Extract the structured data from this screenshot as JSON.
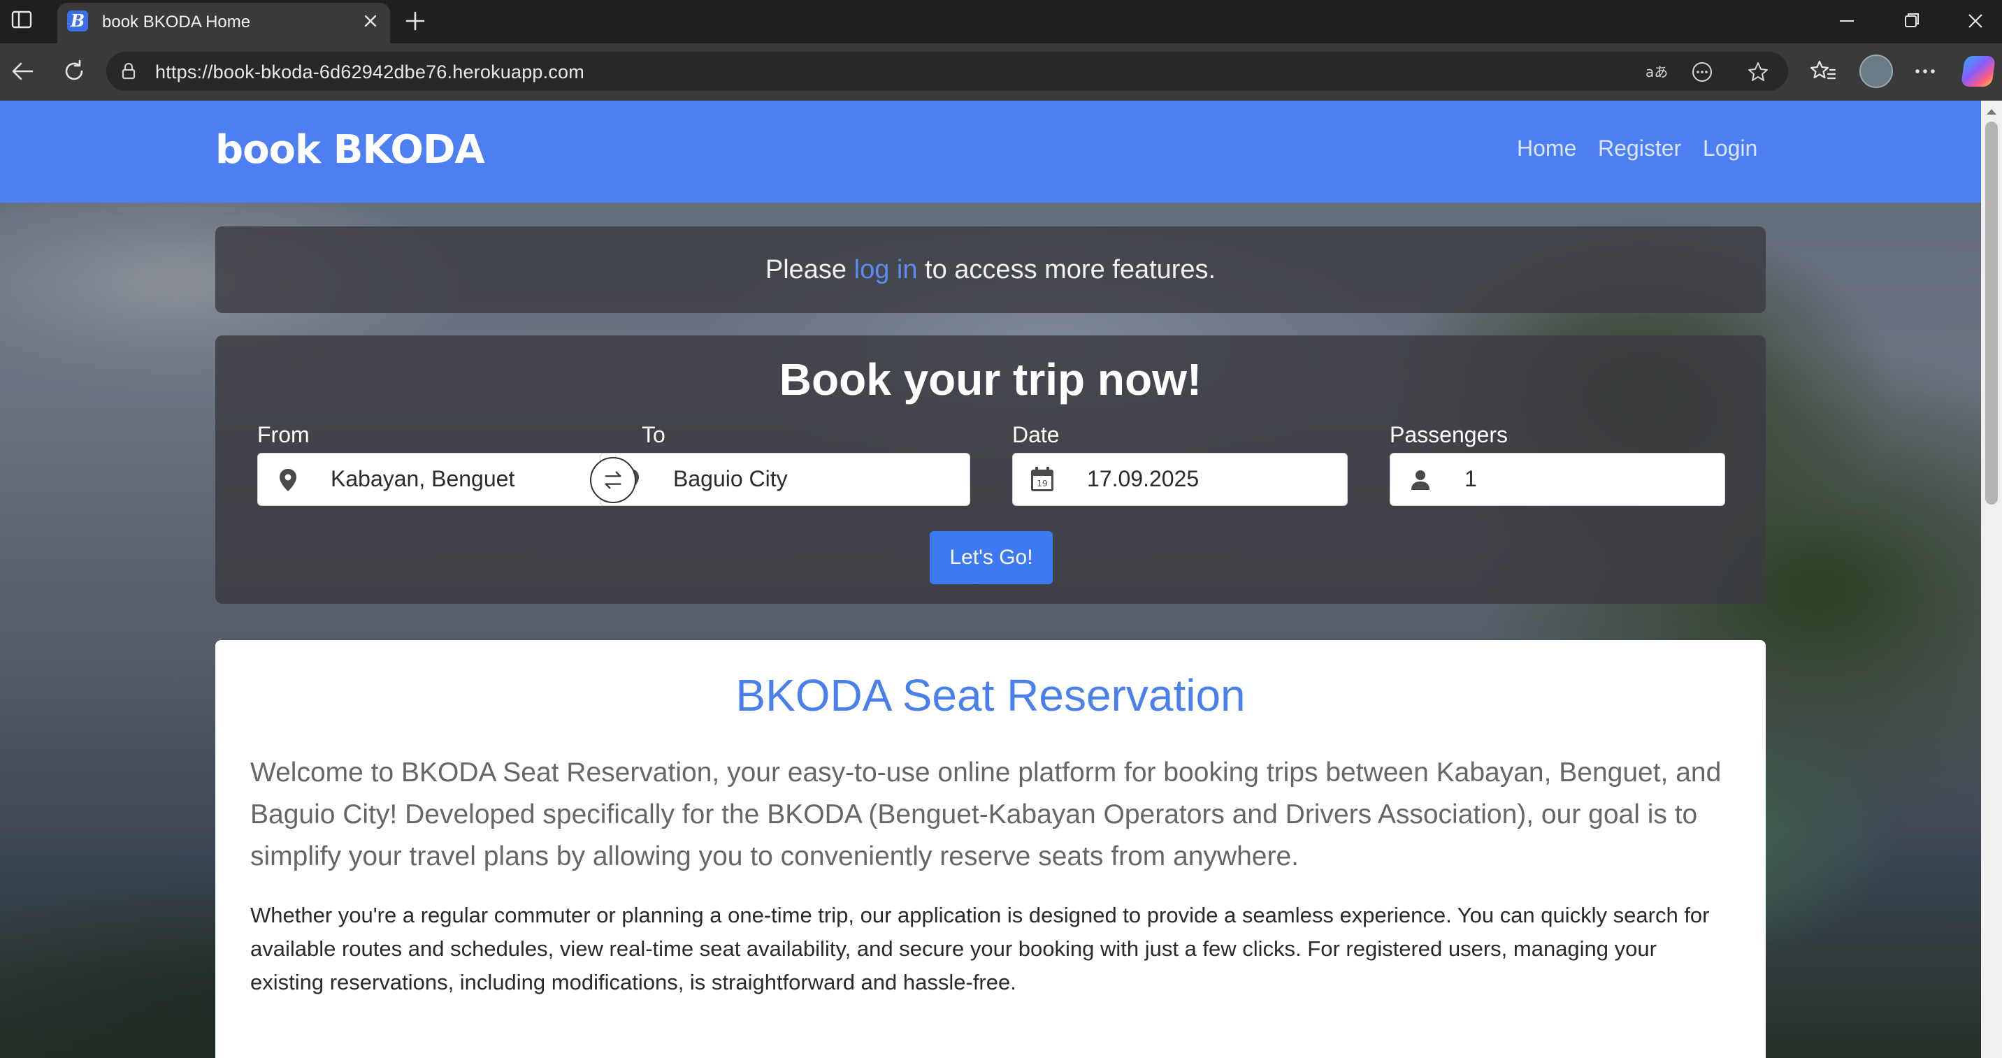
{
  "browser": {
    "tab_title": "book BKODA Home",
    "tab_favicon_letter": "B",
    "url": "https://book-bkoda-6d62942dbe76.herokuapp.com"
  },
  "navbar": {
    "brand": "book BKODA",
    "links": [
      "Home",
      "Register",
      "Login"
    ],
    "color": "#4d7ef2"
  },
  "notice": {
    "prefix": "Please",
    "link_text": "log in",
    "suffix": "to access more features."
  },
  "booking": {
    "heading": "Book your trip now!",
    "from_label": "From",
    "from_value": "Kabayan, Benguet",
    "to_label": "To",
    "to_value": "Baguio City",
    "date_label": "Date",
    "date_value": "17.09.2025",
    "date_icon_day": "19",
    "passengers_label": "Passengers",
    "passengers_value": "1",
    "submit_label": "Let's Go!"
  },
  "about": {
    "title": "BKODA Seat Reservation",
    "lead": "Welcome to BKODA Seat Reservation, your easy-to-use online platform for booking trips between Kabayan, Benguet, and Baguio City! Developed specifically for the BKODA (Benguet-Kabayan Operators and Drivers Association), our goal is to simplify your travel plans by allowing you to conveniently reserve seats from anywhere.",
    "body": "Whether you're a regular commuter or planning a one-time trip, our application is designed to provide a seamless experience. You can quickly search for available routes and schedules, view real-time seat availability, and secure your booking with just a few clicks. For registered users, managing your existing reservations, including modifications, is straightforward and hassle-free."
  }
}
